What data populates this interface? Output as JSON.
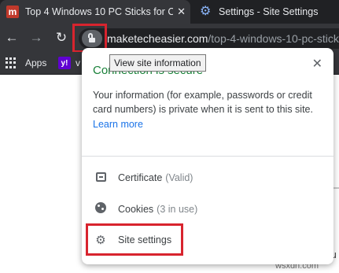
{
  "tabs": [
    {
      "title": "Top 4 Windows 10 PC Sticks for C",
      "favicon": "m",
      "close": "✕"
    },
    {
      "title": "Settings - Site Settings",
      "favicon": "gear-icon"
    }
  ],
  "toolbar": {
    "back": "←",
    "forward": "→",
    "reload": "↻"
  },
  "address": {
    "host": "maketecheasier.com",
    "path": "/top-4-windows-10-pc-stick"
  },
  "bookmarks": {
    "apps_label": "Apps",
    "yahoo_letter": "y!",
    "partial": "v"
  },
  "tooltip": "View site information",
  "popup": {
    "title": "Connection is secure",
    "close": "✕",
    "description": "Your information (for example, passwords or credit card numbers) is private when it is sent to this site.",
    "learn_more": "Learn more",
    "items": [
      {
        "label": "Certificate",
        "detail": "(Valid)",
        "icon": "certificate-icon"
      },
      {
        "label": "Cookies",
        "detail": "(3 in use)",
        "icon": "cookie-icon"
      },
      {
        "label": "Site settings",
        "icon": "gear-icon"
      }
    ]
  },
  "page": {
    "heading_fragment": "I",
    "text_fragment": "Bu"
  },
  "watermark": "wsxdn.com",
  "colors": {
    "secure_green": "#188038",
    "link_blue": "#1a73e8",
    "highlight_red": "#d8242e"
  }
}
